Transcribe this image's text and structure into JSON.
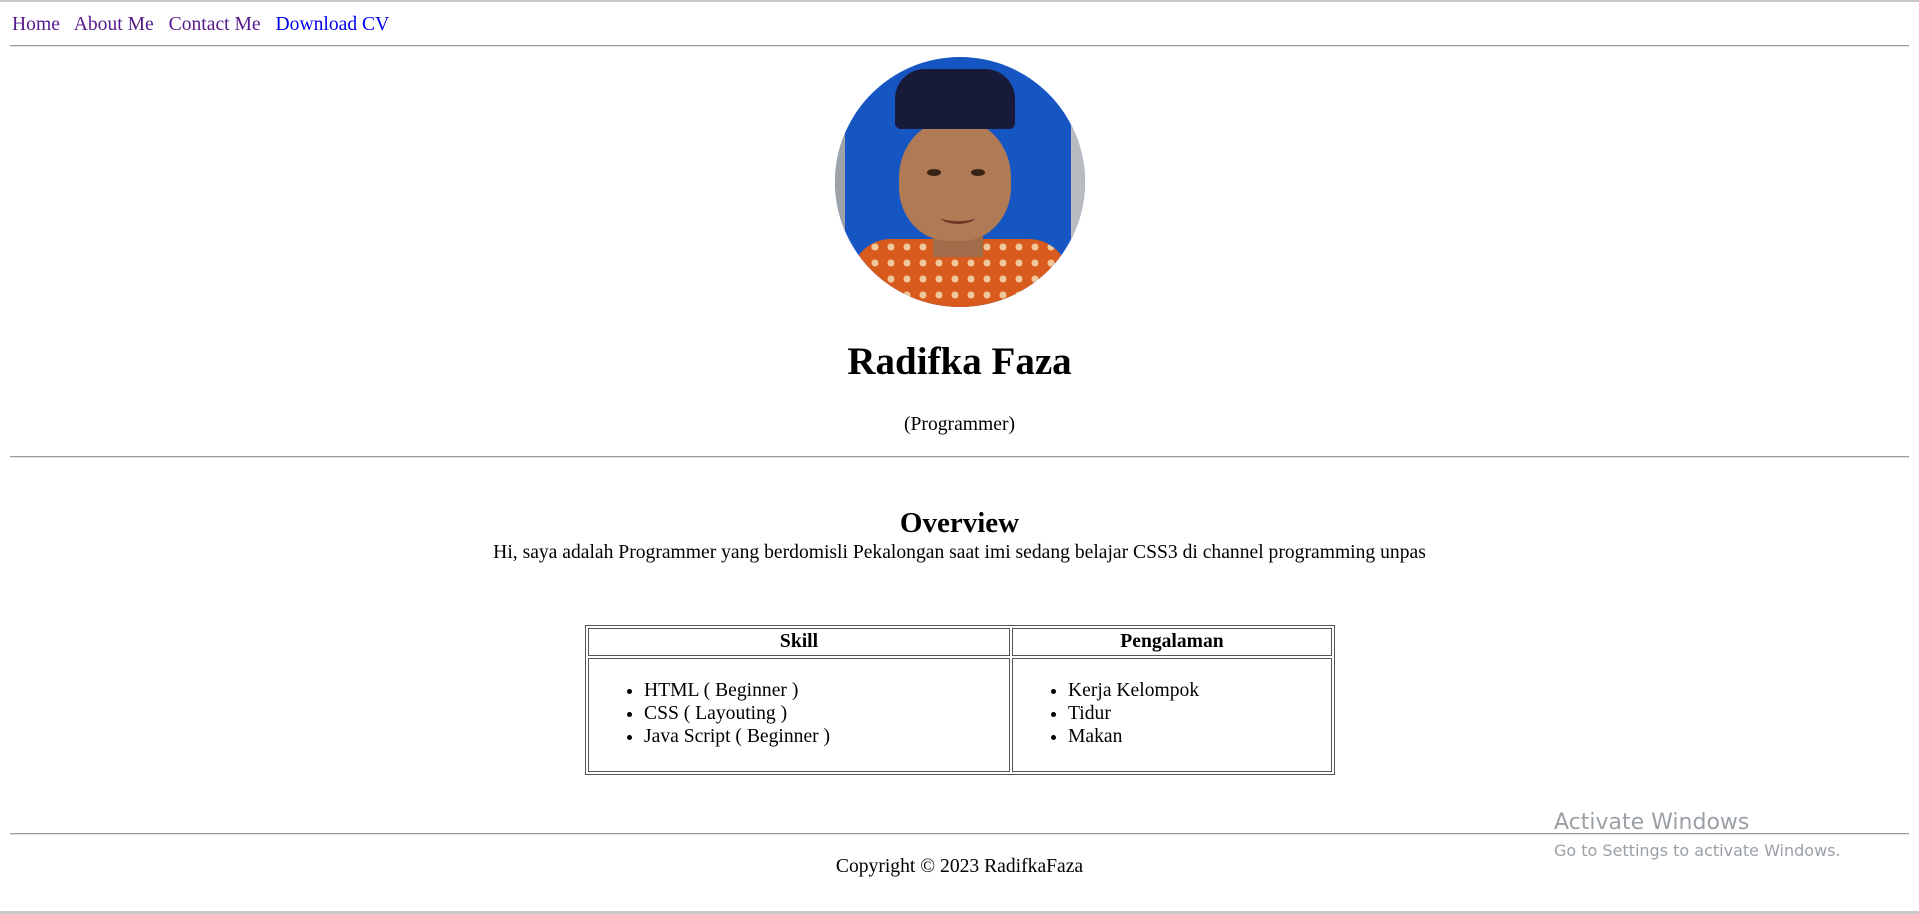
{
  "nav": {
    "items": [
      {
        "label": "Home",
        "visited": true
      },
      {
        "label": "About Me",
        "visited": true
      },
      {
        "label": "Contact Me",
        "visited": true
      },
      {
        "label": "Download CV",
        "visited": false
      }
    ]
  },
  "profile": {
    "name": "Radifka Faza",
    "role": "(Programmer)"
  },
  "overview": {
    "title": "Overview",
    "text": "Hi, saya adalah Programmer yang berdomisli Pekalongan saat imi sedang belajar CSS3 di channel programming unpas"
  },
  "table": {
    "headers": [
      "Skill",
      "Pengalaman"
    ],
    "skills": [
      "HTML ( Beginner )",
      "CSS ( Layouting )",
      "Java Script ( Beginner )"
    ],
    "experience": [
      "Kerja Kelompok",
      "Tidur",
      "Makan"
    ]
  },
  "footer": {
    "copyright": "Copyright © 2023 RadifkaFaza"
  },
  "watermark": {
    "title": "Activate Windows",
    "subtitle": "Go to Settings to activate Windows."
  },
  "colors": {
    "link_visited": "#551a8b",
    "link_unvisited": "#0000ee",
    "avatar_background": "#1556c3"
  }
}
